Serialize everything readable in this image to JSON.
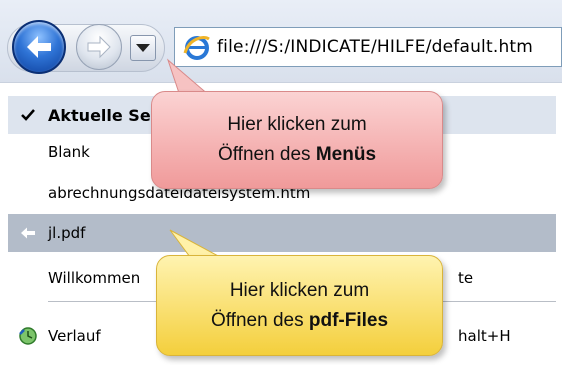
{
  "toolbar": {
    "back_icon": "back-arrow-icon",
    "forward_icon": "forward-arrow-icon",
    "dropdown_icon": "chevron-down-icon",
    "address": "file:///S:/INDICATE/HILFE/default.htm"
  },
  "menu": {
    "current_label": "Aktuelle Seite",
    "blank_label": "Blank",
    "abrech_label": "abrechnungsdateidateisystem.htm",
    "jl_label": "jl.pdf",
    "willkommen_label": "Willkommen",
    "willkommen_suffix": "te",
    "verlauf_label": "Verlauf",
    "verlauf_shortcut": "halt+H"
  },
  "callouts": {
    "menu_line1": "Hier klicken zum",
    "menu_line2_prefix": "Öffnen des ",
    "menu_line2_bold": "Menüs",
    "pdf_line1": "Hier klicken zum",
    "pdf_line2_prefix": "Öffnen des ",
    "pdf_line2_bold": "pdf-Files"
  },
  "colors": {
    "callout_red": "#f4b4b4",
    "callout_yellow": "#f8dd6a",
    "selected_row": "#b3bcc9"
  }
}
